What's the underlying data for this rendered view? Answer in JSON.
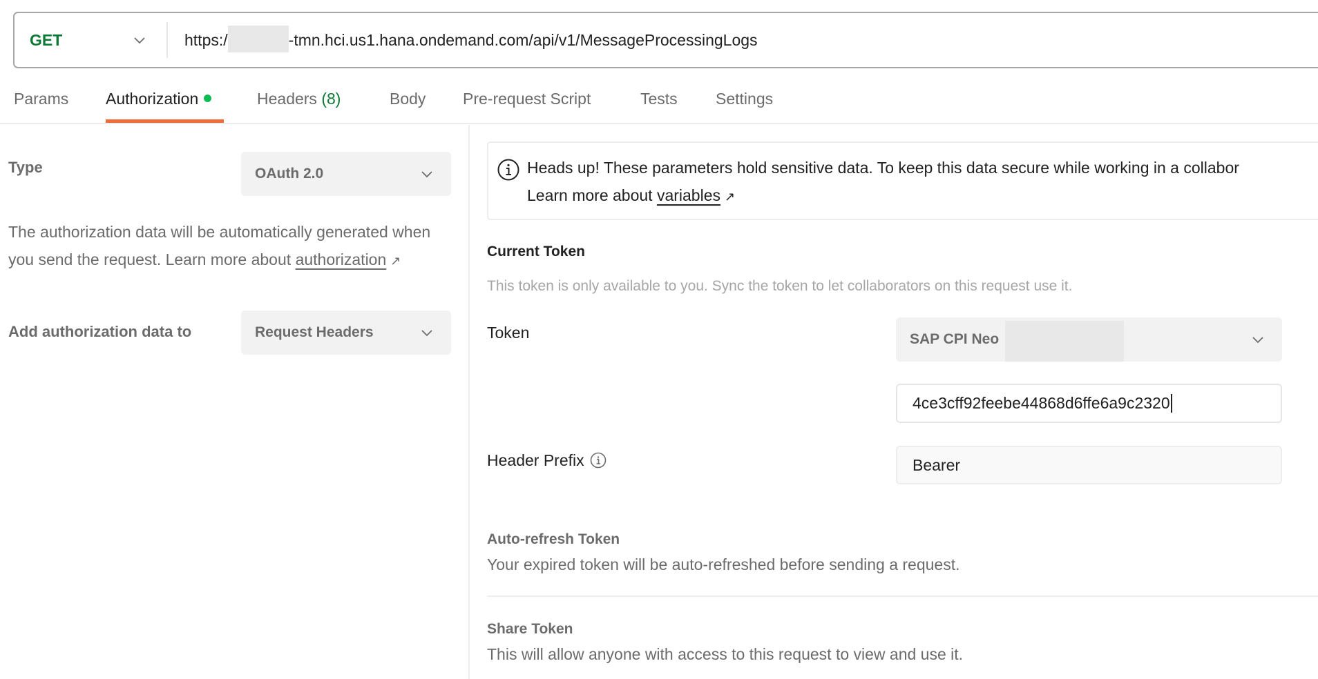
{
  "request": {
    "method": "GET",
    "url_prefix": "https:/",
    "url_suffix": "-tmn.hci.us1.hana.ondemand.com/api/v1/MessageProcessingLogs"
  },
  "tabs": [
    {
      "label": "Params"
    },
    {
      "label": "Authorization",
      "active": true,
      "indicator": "green-dot"
    },
    {
      "label": "Headers",
      "count": "(8)"
    },
    {
      "label": "Body"
    },
    {
      "label": "Pre-request Script"
    },
    {
      "label": "Tests"
    },
    {
      "label": "Settings"
    }
  ],
  "left": {
    "type_label": "Type",
    "type_value": "OAuth 2.0",
    "description": "The authorization data will be automatically generated when you send the request. Learn more about",
    "description_link": "authorization",
    "add_to_label": "Add authorization data to",
    "add_to_value": "Request Headers"
  },
  "notice": {
    "line1": "Heads up! These parameters hold sensitive data. To keep this data secure while working in a collabor",
    "line2_prefix": "Learn more about ",
    "line2_link": "variables"
  },
  "current_token": {
    "heading": "Current Token",
    "subtitle": "This token is only available to you. Sync the token to let collaborators on this request use it.",
    "token_label": "Token",
    "token_select_value": "SAP CPI Neo",
    "token_value": "4ce3cff92feebe44868d6ffe6a9c2320",
    "header_prefix_label": "Header Prefix",
    "header_prefix_value": "Bearer"
  },
  "auto_refresh": {
    "heading": "Auto-refresh Token",
    "description": "Your expired token will be auto-refreshed before sending a request."
  },
  "share_token": {
    "heading": "Share Token",
    "description": "This will allow anyone with access to this request to view and use it."
  },
  "colors": {
    "method_get": "#0b7a35",
    "active_tab_underline": "#f26b3a",
    "status_dot": "#0cbb52"
  }
}
